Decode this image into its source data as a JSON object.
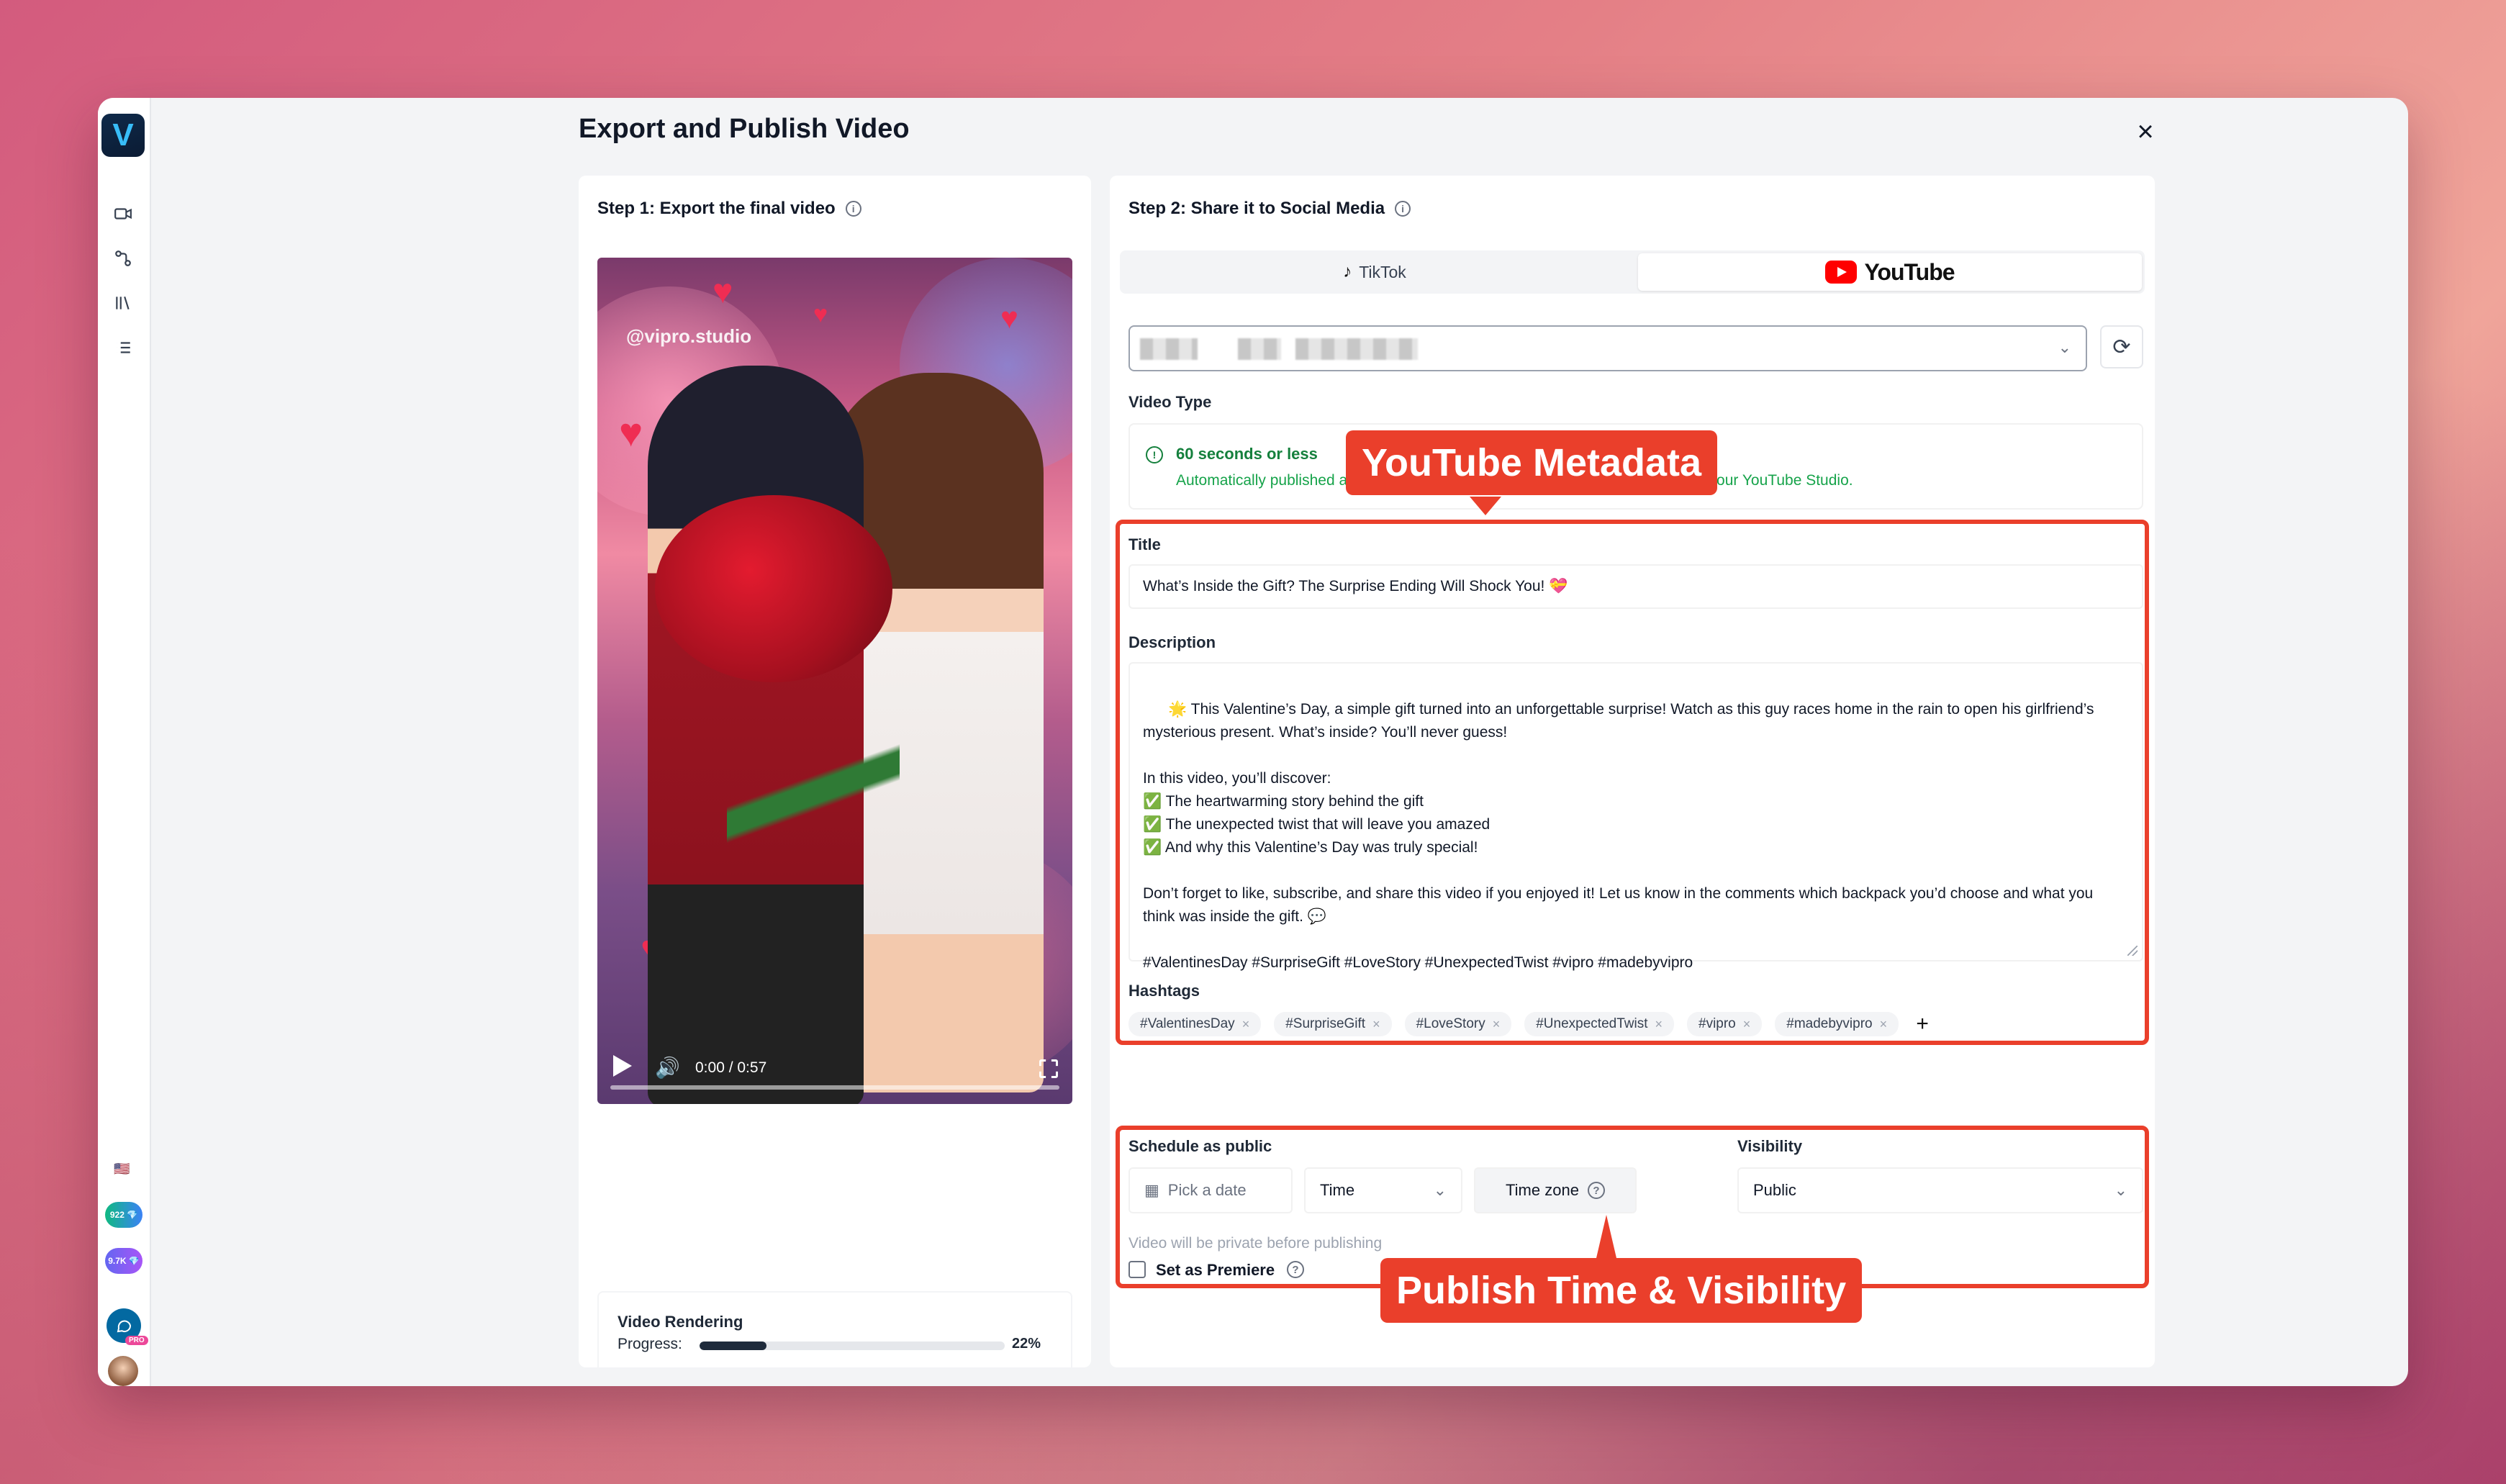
{
  "page": {
    "title": "Export and Publish Video",
    "close_label": "×"
  },
  "sidebar": {
    "logo_letter": "V",
    "flag": "🇺🇸",
    "credit_1": "922 💎",
    "credit_2": "9.7K 💎",
    "pro_badge": "PRO"
  },
  "step1": {
    "title": "Step 1: Export the final video",
    "video": {
      "watermark": "@vipro.studio",
      "time": "0:00 / 0:57"
    },
    "render": {
      "title": "Video Rendering",
      "progress_label": "Progress:",
      "progress_text": "22%",
      "progress_fraction": 0.22
    }
  },
  "step2": {
    "title": "Step 2: Share it to Social Media",
    "tabs": {
      "tiktok": "TikTok",
      "youtube": "YouTube"
    },
    "video_type": {
      "label": "Video Type",
      "option_title": "60 seconds or less",
      "option_desc": "Automatically published as a YouTube Short. You can find it in the Shorts tab of your YouTube Studio."
    },
    "title_field": {
      "label": "Title",
      "value": "What’s Inside the Gift? The Surprise Ending Will Shock You! 💝"
    },
    "description": {
      "label": "Description",
      "value": "🌟 This Valentine’s Day, a simple gift turned into an unforgettable surprise! Watch as this guy races home in the rain to open his girlfriend’s mysterious present. What’s inside? You’ll never guess!\n\nIn this video, you’ll discover:\n✅ The heartwarming story behind the gift\n✅ The unexpected twist that will leave you amazed\n✅ And why this Valentine’s Day was truly special!\n\nDon’t forget to like, subscribe, and share this video if you enjoyed it! Let us know in the comments which backpack you’d choose and what you think was inside the gift. 💬\n\n#ValentinesDay #SurpriseGift #LoveStory #UnexpectedTwist #vipro #madebyvipro"
    },
    "hashtags": {
      "label": "Hashtags",
      "items": [
        "#ValentinesDay",
        "#SurpriseGift",
        "#LoveStory",
        "#UnexpectedTwist",
        "#vipro",
        "#madebyvipro"
      ],
      "add_label": "+"
    },
    "schedule": {
      "label": "Schedule as public",
      "date_placeholder": "Pick a date",
      "time_label": "Time",
      "timezone_label": "Time zone",
      "note": "Video will be private before publishing",
      "premiere_label": "Set as Premiere"
    },
    "visibility": {
      "label": "Visibility",
      "value": "Public"
    }
  },
  "annotations": {
    "metadata_callout": "YouTube Metadata",
    "publish_callout": "Publish Time & Visibility",
    "color": "#ea3f2b"
  }
}
